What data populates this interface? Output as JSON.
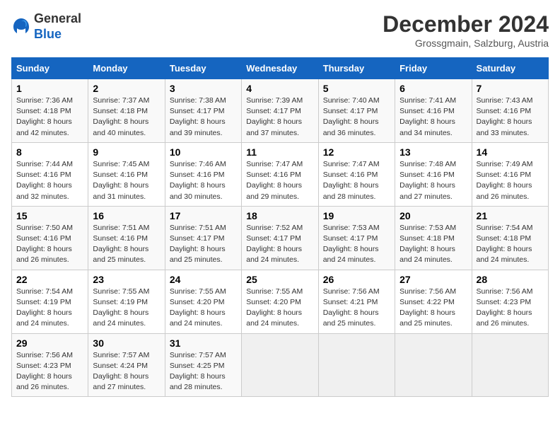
{
  "header": {
    "logo_general": "General",
    "logo_blue": "Blue",
    "month_title": "December 2024",
    "location": "Grossgmain, Salzburg, Austria"
  },
  "calendar": {
    "days_of_week": [
      "Sunday",
      "Monday",
      "Tuesday",
      "Wednesday",
      "Thursday",
      "Friday",
      "Saturday"
    ],
    "weeks": [
      [
        {
          "day": "1",
          "detail": "Sunrise: 7:36 AM\nSunset: 4:18 PM\nDaylight: 8 hours\nand 42 minutes."
        },
        {
          "day": "2",
          "detail": "Sunrise: 7:37 AM\nSunset: 4:18 PM\nDaylight: 8 hours\nand 40 minutes."
        },
        {
          "day": "3",
          "detail": "Sunrise: 7:38 AM\nSunset: 4:17 PM\nDaylight: 8 hours\nand 39 minutes."
        },
        {
          "day": "4",
          "detail": "Sunrise: 7:39 AM\nSunset: 4:17 PM\nDaylight: 8 hours\nand 37 minutes."
        },
        {
          "day": "5",
          "detail": "Sunrise: 7:40 AM\nSunset: 4:17 PM\nDaylight: 8 hours\nand 36 minutes."
        },
        {
          "day": "6",
          "detail": "Sunrise: 7:41 AM\nSunset: 4:16 PM\nDaylight: 8 hours\nand 34 minutes."
        },
        {
          "day": "7",
          "detail": "Sunrise: 7:43 AM\nSunset: 4:16 PM\nDaylight: 8 hours\nand 33 minutes."
        }
      ],
      [
        {
          "day": "8",
          "detail": "Sunrise: 7:44 AM\nSunset: 4:16 PM\nDaylight: 8 hours\nand 32 minutes."
        },
        {
          "day": "9",
          "detail": "Sunrise: 7:45 AM\nSunset: 4:16 PM\nDaylight: 8 hours\nand 31 minutes."
        },
        {
          "day": "10",
          "detail": "Sunrise: 7:46 AM\nSunset: 4:16 PM\nDaylight: 8 hours\nand 30 minutes."
        },
        {
          "day": "11",
          "detail": "Sunrise: 7:47 AM\nSunset: 4:16 PM\nDaylight: 8 hours\nand 29 minutes."
        },
        {
          "day": "12",
          "detail": "Sunrise: 7:47 AM\nSunset: 4:16 PM\nDaylight: 8 hours\nand 28 minutes."
        },
        {
          "day": "13",
          "detail": "Sunrise: 7:48 AM\nSunset: 4:16 PM\nDaylight: 8 hours\nand 27 minutes."
        },
        {
          "day": "14",
          "detail": "Sunrise: 7:49 AM\nSunset: 4:16 PM\nDaylight: 8 hours\nand 26 minutes."
        }
      ],
      [
        {
          "day": "15",
          "detail": "Sunrise: 7:50 AM\nSunset: 4:16 PM\nDaylight: 8 hours\nand 26 minutes."
        },
        {
          "day": "16",
          "detail": "Sunrise: 7:51 AM\nSunset: 4:16 PM\nDaylight: 8 hours\nand 25 minutes."
        },
        {
          "day": "17",
          "detail": "Sunrise: 7:51 AM\nSunset: 4:17 PM\nDaylight: 8 hours\nand 25 minutes."
        },
        {
          "day": "18",
          "detail": "Sunrise: 7:52 AM\nSunset: 4:17 PM\nDaylight: 8 hours\nand 24 minutes."
        },
        {
          "day": "19",
          "detail": "Sunrise: 7:53 AM\nSunset: 4:17 PM\nDaylight: 8 hours\nand 24 minutes."
        },
        {
          "day": "20",
          "detail": "Sunrise: 7:53 AM\nSunset: 4:18 PM\nDaylight: 8 hours\nand 24 minutes."
        },
        {
          "day": "21",
          "detail": "Sunrise: 7:54 AM\nSunset: 4:18 PM\nDaylight: 8 hours\nand 24 minutes."
        }
      ],
      [
        {
          "day": "22",
          "detail": "Sunrise: 7:54 AM\nSunset: 4:19 PM\nDaylight: 8 hours\nand 24 minutes."
        },
        {
          "day": "23",
          "detail": "Sunrise: 7:55 AM\nSunset: 4:19 PM\nDaylight: 8 hours\nand 24 minutes."
        },
        {
          "day": "24",
          "detail": "Sunrise: 7:55 AM\nSunset: 4:20 PM\nDaylight: 8 hours\nand 24 minutes."
        },
        {
          "day": "25",
          "detail": "Sunrise: 7:55 AM\nSunset: 4:20 PM\nDaylight: 8 hours\nand 24 minutes."
        },
        {
          "day": "26",
          "detail": "Sunrise: 7:56 AM\nSunset: 4:21 PM\nDaylight: 8 hours\nand 25 minutes."
        },
        {
          "day": "27",
          "detail": "Sunrise: 7:56 AM\nSunset: 4:22 PM\nDaylight: 8 hours\nand 25 minutes."
        },
        {
          "day": "28",
          "detail": "Sunrise: 7:56 AM\nSunset: 4:23 PM\nDaylight: 8 hours\nand 26 minutes."
        }
      ],
      [
        {
          "day": "29",
          "detail": "Sunrise: 7:56 AM\nSunset: 4:23 PM\nDaylight: 8 hours\nand 26 minutes."
        },
        {
          "day": "30",
          "detail": "Sunrise: 7:57 AM\nSunset: 4:24 PM\nDaylight: 8 hours\nand 27 minutes."
        },
        {
          "day": "31",
          "detail": "Sunrise: 7:57 AM\nSunset: 4:25 PM\nDaylight: 8 hours\nand 28 minutes."
        },
        {
          "day": "",
          "detail": ""
        },
        {
          "day": "",
          "detail": ""
        },
        {
          "day": "",
          "detail": ""
        },
        {
          "day": "",
          "detail": ""
        }
      ]
    ]
  }
}
